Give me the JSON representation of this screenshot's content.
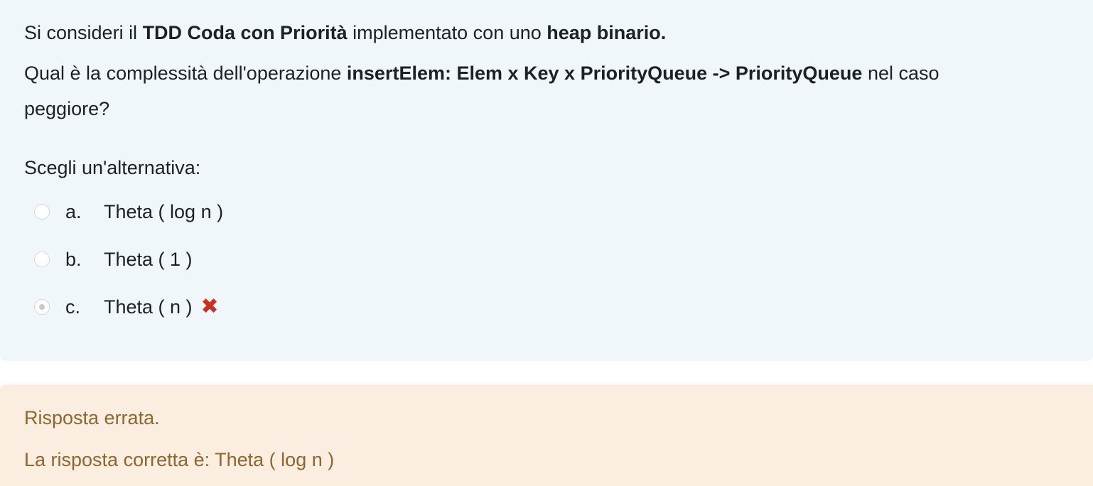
{
  "question": {
    "intro_pre": "Si consideri il ",
    "intro_bold1": "TDD Coda con Priorità",
    "intro_mid": " implementato con uno ",
    "intro_bold2": "heap binario.",
    "q_pre": "Qual è la complessità dell'operazione ",
    "q_bold": "insertElem: Elem x Key x PriorityQueue -> PriorityQueue",
    "q_post": " nel caso",
    "q_line2": "peggiore?",
    "prompt": "Scegli un'alternativa:"
  },
  "answers": [
    {
      "letter": "a.",
      "text": "Theta ( log n )",
      "checked": false
    },
    {
      "letter": "b.",
      "text": "Theta ( 1 )",
      "checked": false
    },
    {
      "letter": "c.",
      "text": "Theta ( n )",
      "checked": true
    }
  ],
  "wrong_mark": "✖",
  "feedback": {
    "result": "Risposta errata.",
    "correct": "La risposta corretta è: Theta ( log n )"
  },
  "colors": {
    "question_bg": "#eff7fb",
    "feedback_bg": "#fbeee0",
    "feedback_text": "#8e662e",
    "wrong_icon": "#ca3120"
  }
}
